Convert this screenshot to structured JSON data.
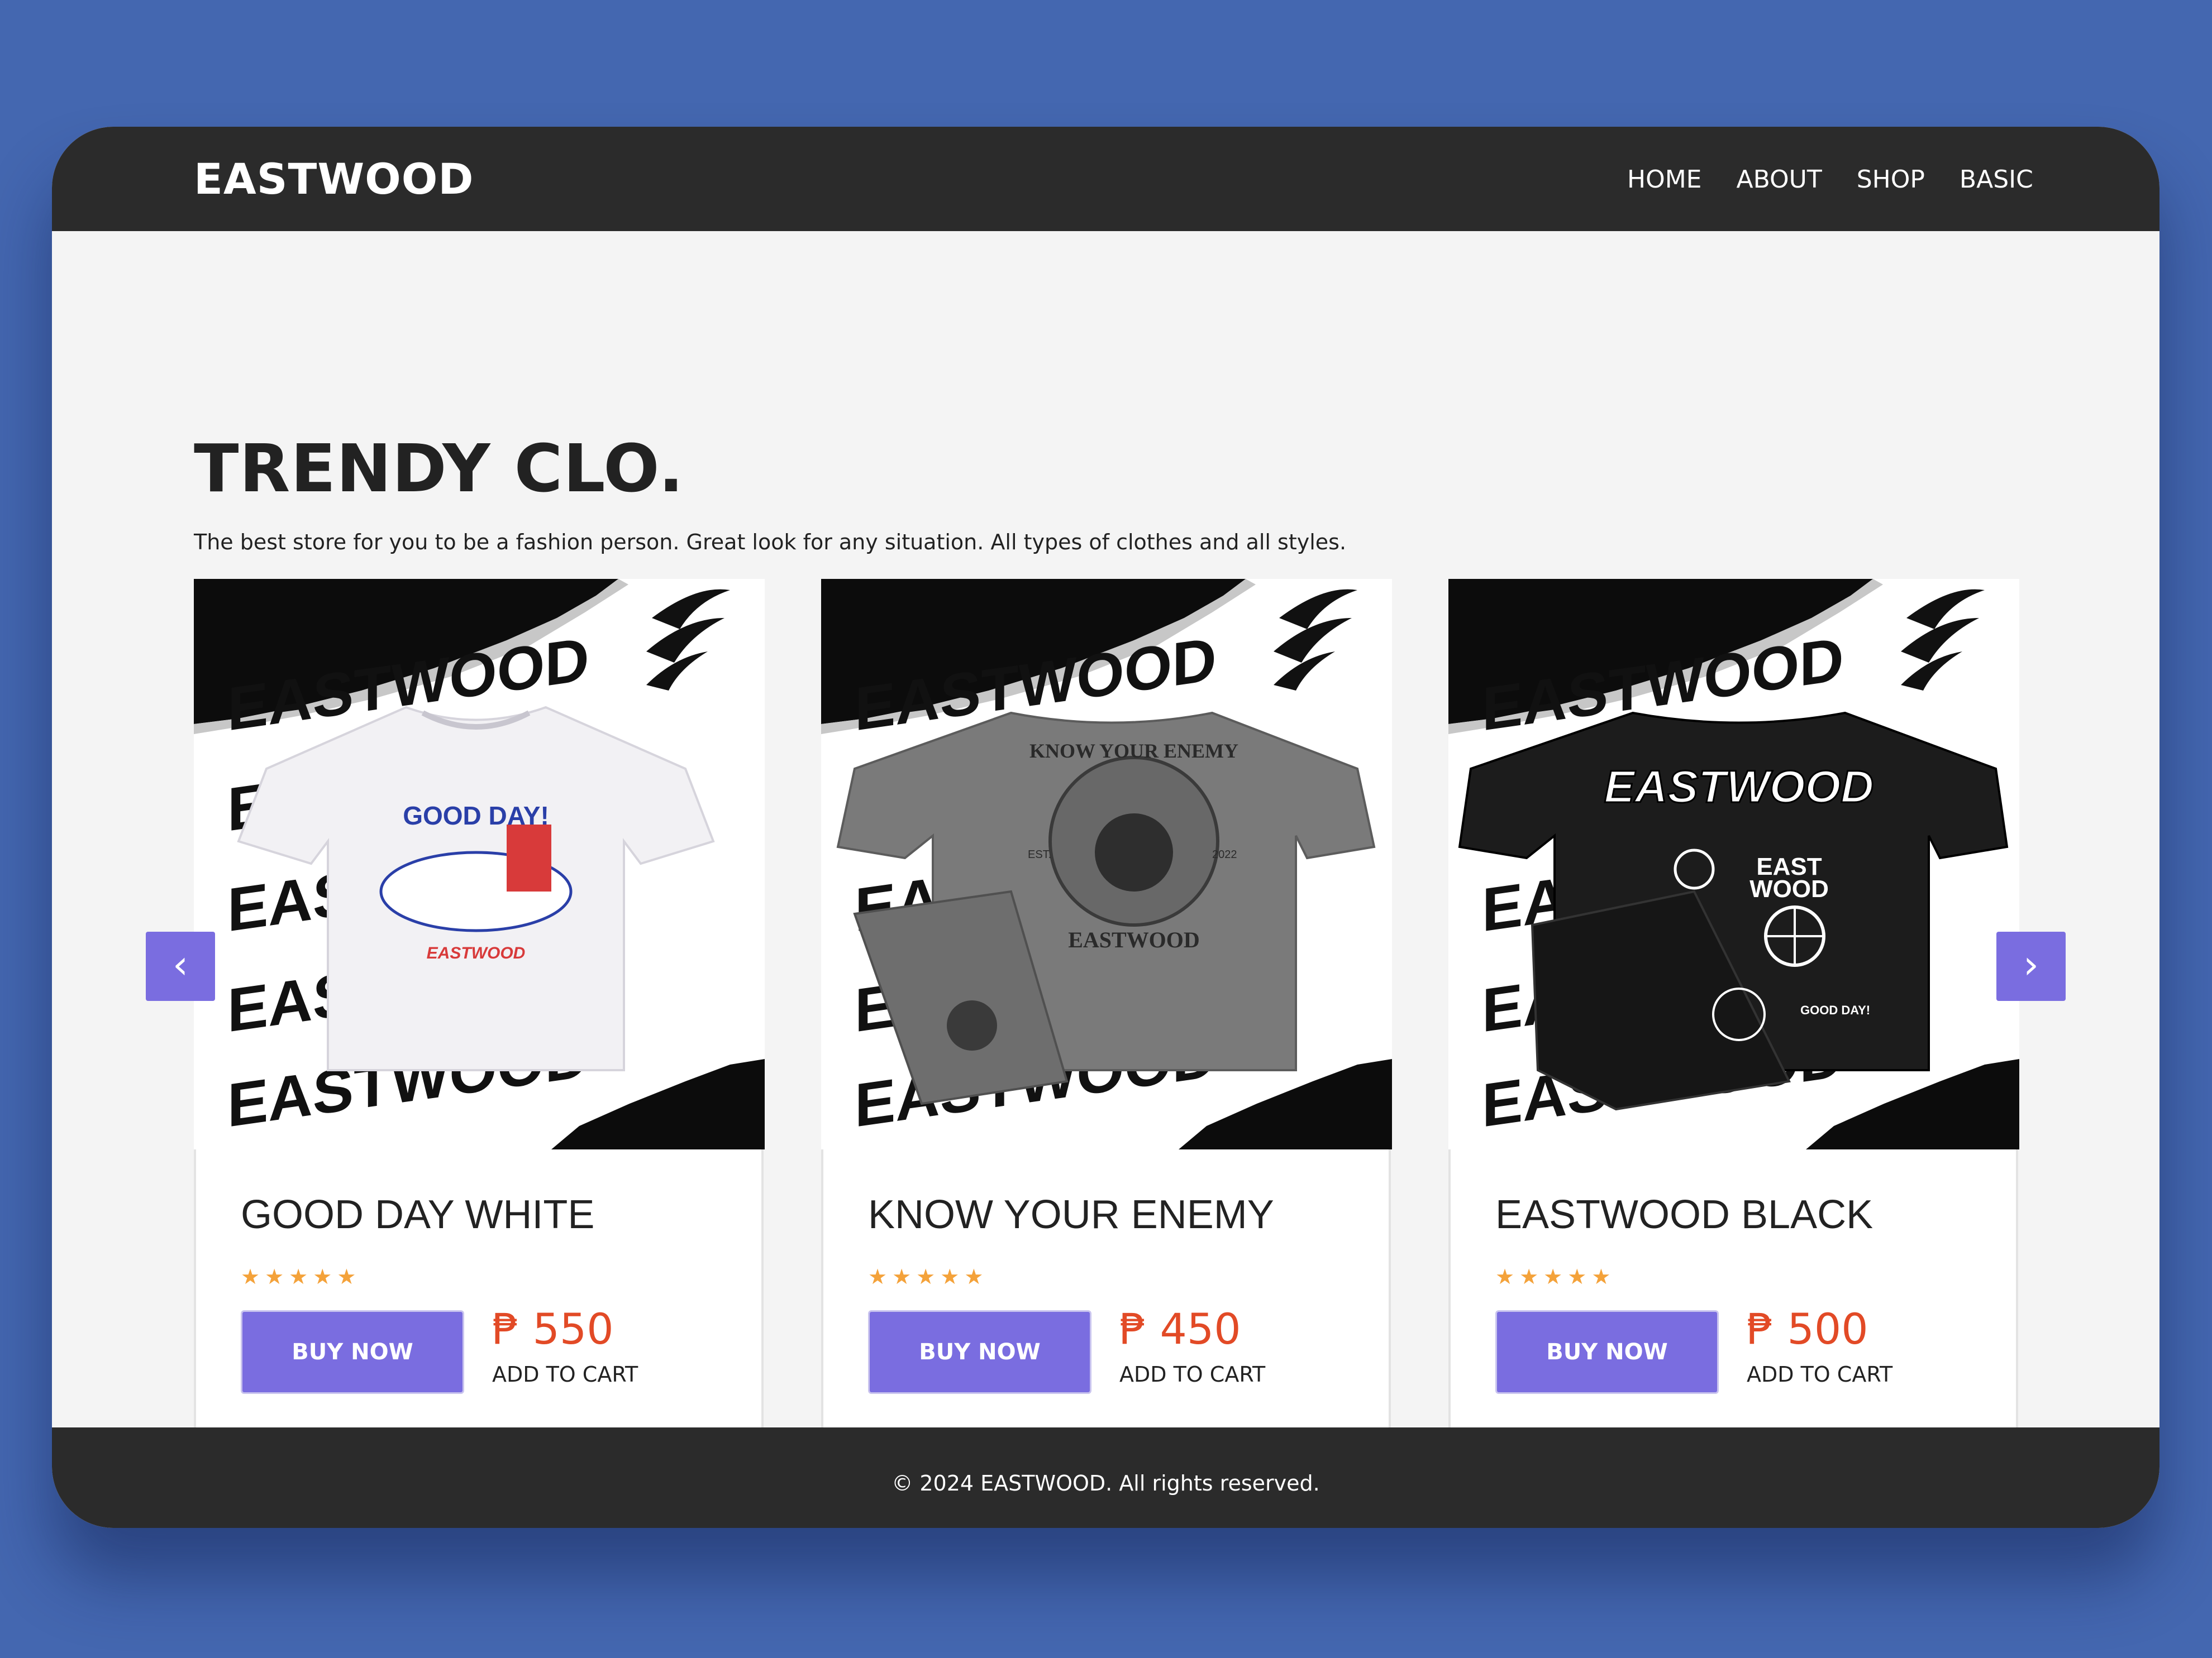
{
  "navbar": {
    "brand": "EASTWOOD",
    "links": [
      "HOME",
      "ABOUT",
      "SHOP",
      "BASIC"
    ]
  },
  "hero": {
    "title": "TRENDY CLO.",
    "subtitle": "The best store for you to be a fashion person. Great look for any situation. All types of clothes and all styles."
  },
  "products": [
    {
      "name": "GOOD DAY WHITE",
      "rating": 5,
      "stars": "★★★★★",
      "buy_label": "BUY NOW",
      "price": "₱ 550",
      "cart_label": "ADD TO CART",
      "shirt_color": "#f2f1f4",
      "graphic_text": [
        "GOOD DAY!",
        "EASTWOOD"
      ]
    },
    {
      "name": "KNOW YOUR ENEMY",
      "rating": 5,
      "stars": "★★★★★",
      "buy_label": "BUY NOW",
      "price": "₱ 450",
      "cart_label": "ADD TO CART",
      "shirt_color": "#7a7a7a",
      "graphic_text": [
        "KNOW YOUR ENEMY",
        "EASTWOOD",
        "EST.",
        "2022"
      ]
    },
    {
      "name": "EASTWOOD BLACK",
      "rating": 5,
      "stars": "★★★★★",
      "buy_label": "BUY NOW",
      "price": "₱ 500",
      "cart_label": "ADD TO CART",
      "shirt_color": "#1c1c1c",
      "graphic_text": [
        "EASTWOOD",
        "EAST",
        "WOOD",
        "GOOD DAY!"
      ]
    }
  ],
  "card_backdrop_text": "EASTWOOD",
  "carousel": {
    "prev_icon": "chevron-left-icon",
    "next_icon": "chevron-right-icon",
    "prev_glyph": "‹",
    "next_glyph": "›"
  },
  "footer": {
    "copyright": "© 2024 EASTWOOD. All rights reserved."
  },
  "colors": {
    "page_background": "#4467b0",
    "header_footer": "#2b2b2b",
    "accent": "#7a6de0",
    "price": "#e24a26",
    "star": "#f4a23a"
  }
}
